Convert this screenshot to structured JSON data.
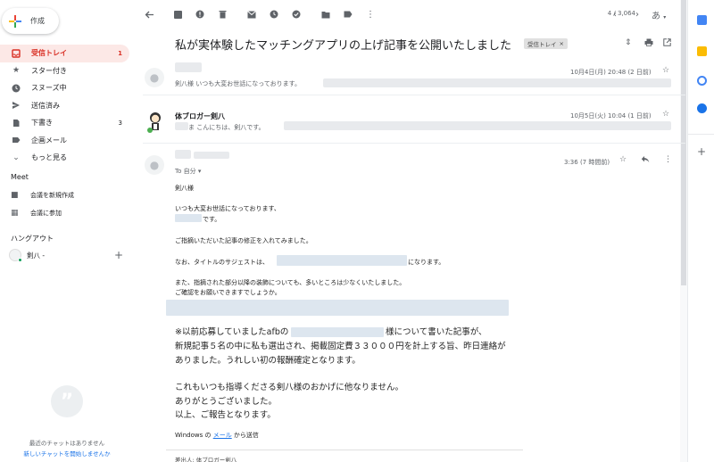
{
  "sidebar": {
    "compose_label": "作成",
    "items": [
      {
        "label": "受信トレイ",
        "count": "1",
        "icon": "inbox-icon"
      },
      {
        "label": "スター付き",
        "count": "",
        "icon": "star-icon"
      },
      {
        "label": "スヌーズ中",
        "count": "",
        "icon": "clock-icon"
      },
      {
        "label": "送信済み",
        "count": "",
        "icon": "send-icon"
      },
      {
        "label": "下書き",
        "count": "3",
        "icon": "draft-icon"
      },
      {
        "label": "企画メール",
        "count": "",
        "icon": "label-icon"
      },
      {
        "label": "もっと見る",
        "count": "",
        "icon": "chevron-down-icon"
      }
    ],
    "meet_title": "Meet",
    "meet_new": "会議を新規作成",
    "meet_join": "会議に参加",
    "hangouts_title": "ハングアウト",
    "hangouts_user": "剣八 -",
    "chat_empty": "最近のチャットはありません",
    "chat_start": "新しいチャットを開始しませんか"
  },
  "toolbar": {
    "pager": "4 / 3,064",
    "input_tool": "あ"
  },
  "thread": {
    "subject": "私が実体験したマッチングアプリの上げ記事を公開いたしました",
    "label_badge": "受信トレイ",
    "badge_close": "×"
  },
  "messages": [
    {
      "date": "10月4日(月) 20:48 (2 日前)",
      "snippet": "剣八様 いつも大変お世話になっております。"
    },
    {
      "from": "体ブロガー剣八",
      "date": "10月5日(火) 10:04 (1 日前)",
      "snippet": "ま こんにちは、剣八です。"
    },
    {
      "date": "3:36 (7 時間前)",
      "to": "To 自分 ▾"
    }
  ],
  "body": {
    "greeting": "剣八様",
    "line1": "いつも大変お世話になっております、",
    "line2": "です。",
    "line3": "ご指摘いただいた記事の修正を入れてみました。",
    "line4a": "なお、タイトルのサジェストは、",
    "line4b": "になります。",
    "line5": "また、指摘された部分以降の装飾についても、多いところは少なくいたしました。",
    "line6": "ご確認をお願いできますでしょうか。",
    "big1a": "※以前応募していましたafbの",
    "big1b": "様について書いた記事が、",
    "big2": "新規記事５名の中に私も選出され、掲載固定費３３０００円を計上する旨、昨日連絡が",
    "big3": "ありました。うれしい初の報酬確定となります。",
    "big4": "これもいつも指導くださる剣八様のおかげに他なりません。",
    "big5": "ありがとうございました。",
    "big6": "以上、ご報告となります。",
    "sig_a": "Windows の ",
    "sig_link": "メール",
    "sig_b": " から送信",
    "footer": "差出人: 体ブロガー剣八"
  }
}
